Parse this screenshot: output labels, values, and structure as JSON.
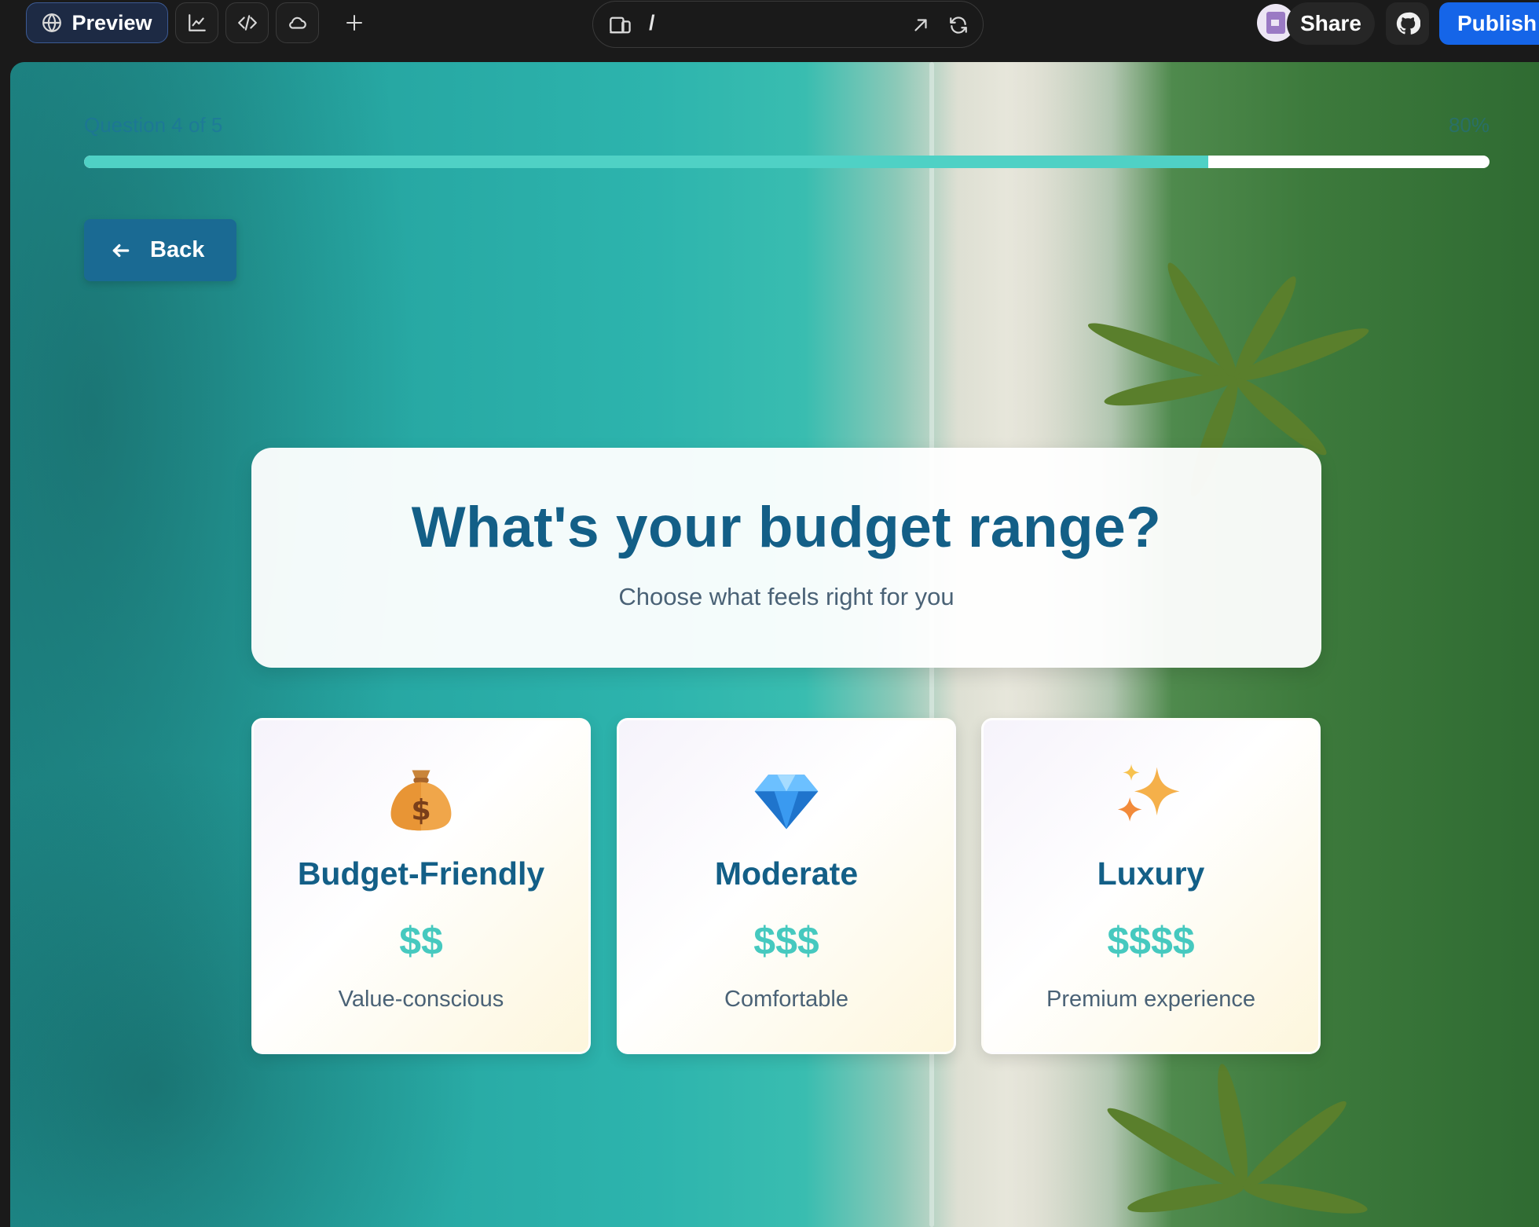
{
  "toolbar": {
    "preview_label": "Preview",
    "url_path": "/",
    "share_label": "Share",
    "publish_label": "Publish"
  },
  "quiz": {
    "progress_label": "Question 4 of 5",
    "progress_percent_text": "80%",
    "progress_fraction": 0.8,
    "back_label": "Back",
    "question": "What's your budget range?",
    "subtitle": "Choose what feels right for you",
    "options": [
      {
        "icon": "money-bag-icon",
        "title": "Budget-Friendly",
        "price": "$$",
        "description": "Value-conscious"
      },
      {
        "icon": "gem-icon",
        "title": "Moderate",
        "price": "$$$",
        "description": "Comfortable"
      },
      {
        "icon": "sparkles-icon",
        "title": "Luxury",
        "price": "$$$$",
        "description": "Premium experience"
      }
    ]
  },
  "colors": {
    "brand_dark": "#135f87",
    "accent_teal": "#4fd1c5",
    "publish_blue": "#1565e8"
  }
}
